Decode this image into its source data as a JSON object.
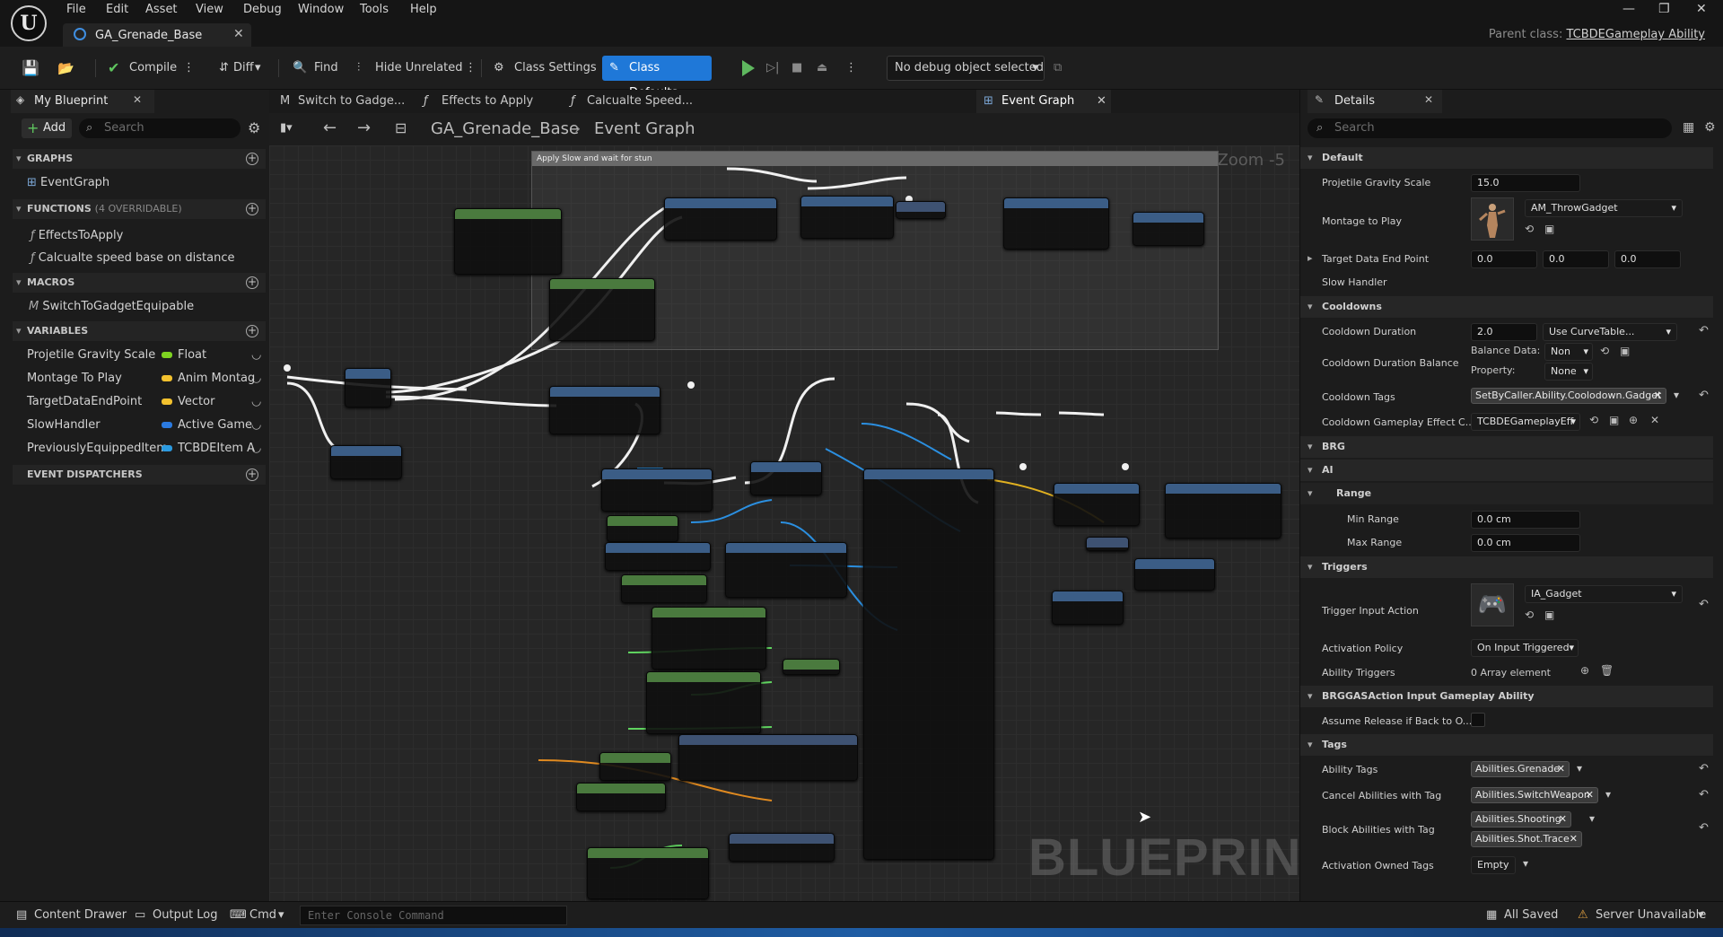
{
  "menu": [
    "File",
    "Edit",
    "Asset",
    "View",
    "Debug",
    "Window",
    "Tools",
    "Help"
  ],
  "doc_tab": "GA_Grenade_Base",
  "parent_class": {
    "label": "Parent class:",
    "value": "TCBDEGameplay Ability"
  },
  "toolbar": {
    "compile": "Compile",
    "diff": "Diff",
    "find": "Find",
    "hide_unrelated": "Hide Unrelated",
    "class_settings": "Class Settings",
    "class_defaults": "Class Defaults",
    "debug_object": "No debug object selected"
  },
  "my_blueprint": {
    "tab": "My Blueprint",
    "add": "Add",
    "search_placeholder": "Search",
    "graphs_header": "GRAPHS",
    "graphs": [
      "EventGraph"
    ],
    "functions_header": "FUNCTIONS",
    "functions_overridable": "(4 OVERRIDABLE)",
    "functions": [
      "EffectsToApply",
      "Calcualte speed base on distance"
    ],
    "macros_header": "MACROS",
    "macros": [
      "SwitchToGadgetEquipable"
    ],
    "variables_header": "VARIABLES",
    "variables": [
      {
        "name": "Projetile Gravity Scale",
        "type": "Float",
        "color": "#7ed321"
      },
      {
        "name": "Montage To Play",
        "type": "Anim Montag",
        "color": "#f2c12e"
      },
      {
        "name": "TargetDataEndPoint",
        "type": "Vector",
        "color": "#f2c12e"
      },
      {
        "name": "SlowHandler",
        "type": "Active Game",
        "color": "#2b7ae0"
      },
      {
        "name": "PreviouslyEquippedItem",
        "type": "TCBDEItem A",
        "color": "#2b9ae0"
      }
    ],
    "dispatchers_header": "EVENT DISPATCHERS"
  },
  "graph_tabs": [
    "Switch to Gadge...",
    "Effects to Apply",
    "Calcualte Speed...",
    "Event Graph"
  ],
  "graph": {
    "breadcrumb_root": "GA_Grenade_Base",
    "breadcrumb_leaf": "Event Graph",
    "zoom": "Zoom -5",
    "comment": "Apply Slow and wait for stun",
    "watermark": "BLUEPRINT"
  },
  "details": {
    "tab": "Details",
    "search_placeholder": "Search",
    "cat_default": "Default",
    "projetile_gravity_label": "Projetile Gravity Scale",
    "projetile_gravity_value": "15.0",
    "montage_label": "Montage to Play",
    "montage_value": "AM_ThrowGadget",
    "target_end_label": "Target Data End Point",
    "target_end_x": "0.0",
    "target_end_y": "0.0",
    "target_end_z": "0.0",
    "slow_handler_label": "Slow Handler",
    "cat_cooldowns": "Cooldowns",
    "cooldown_duration_label": "Cooldown Duration",
    "cooldown_duration_value": "2.0",
    "cooldown_curve": "Use CurveTable...",
    "cooldown_balance_label": "Cooldown Duration Balance",
    "balance_data_label": "Balance Data:",
    "balance_data_value": "Non",
    "property_label": "Property:",
    "property_value": "None",
    "cooldown_tags_label": "Cooldown Tags",
    "cooldown_tag": "SetByCaller.Ability.Coolodown.Gadget",
    "cooldown_ge_label": "Cooldown Gameplay Effect C...",
    "cooldown_ge_value": "TCBDEGameplayEff",
    "cat_brg": "BRG",
    "cat_ai": "AI",
    "cat_range": "Range",
    "min_range_label": "Min Range",
    "min_range_value": "0.0 cm",
    "max_range_label": "Max Range",
    "max_range_value": "0.0 cm",
    "cat_triggers": "Triggers",
    "trigger_action_label": "Trigger Input Action",
    "trigger_action_value": "IA_Gadget",
    "activation_policy_label": "Activation Policy",
    "activation_policy_value": "On Input Triggered",
    "ability_triggers_label": "Ability Triggers",
    "ability_triggers_value": "0 Array element",
    "cat_brggas": "BRGGASAction Input Gameplay Ability",
    "assume_release_label": "Assume Release if Back to O...",
    "cat_tags": "Tags",
    "ability_tags_label": "Ability Tags",
    "ability_tag": "Abilities.Grenade",
    "cancel_tags_label": "Cancel Abilities with Tag",
    "cancel_tag": "Abilities.SwitchWeapon",
    "block_tags_label": "Block Abilities with Tag",
    "block_tag_1": "Abilities.Shooting",
    "block_tag_2": "Abilities.Shot.Trace",
    "activation_owned_label": "Activation Owned Tags",
    "activation_owned_value": "Empty"
  },
  "statusbar": {
    "content_drawer": "Content Drawer",
    "output_log": "Output Log",
    "cmd": "Cmd",
    "console_placeholder": "Enter Console Command",
    "all_saved": "All Saved",
    "server": "Server Unavailable"
  }
}
